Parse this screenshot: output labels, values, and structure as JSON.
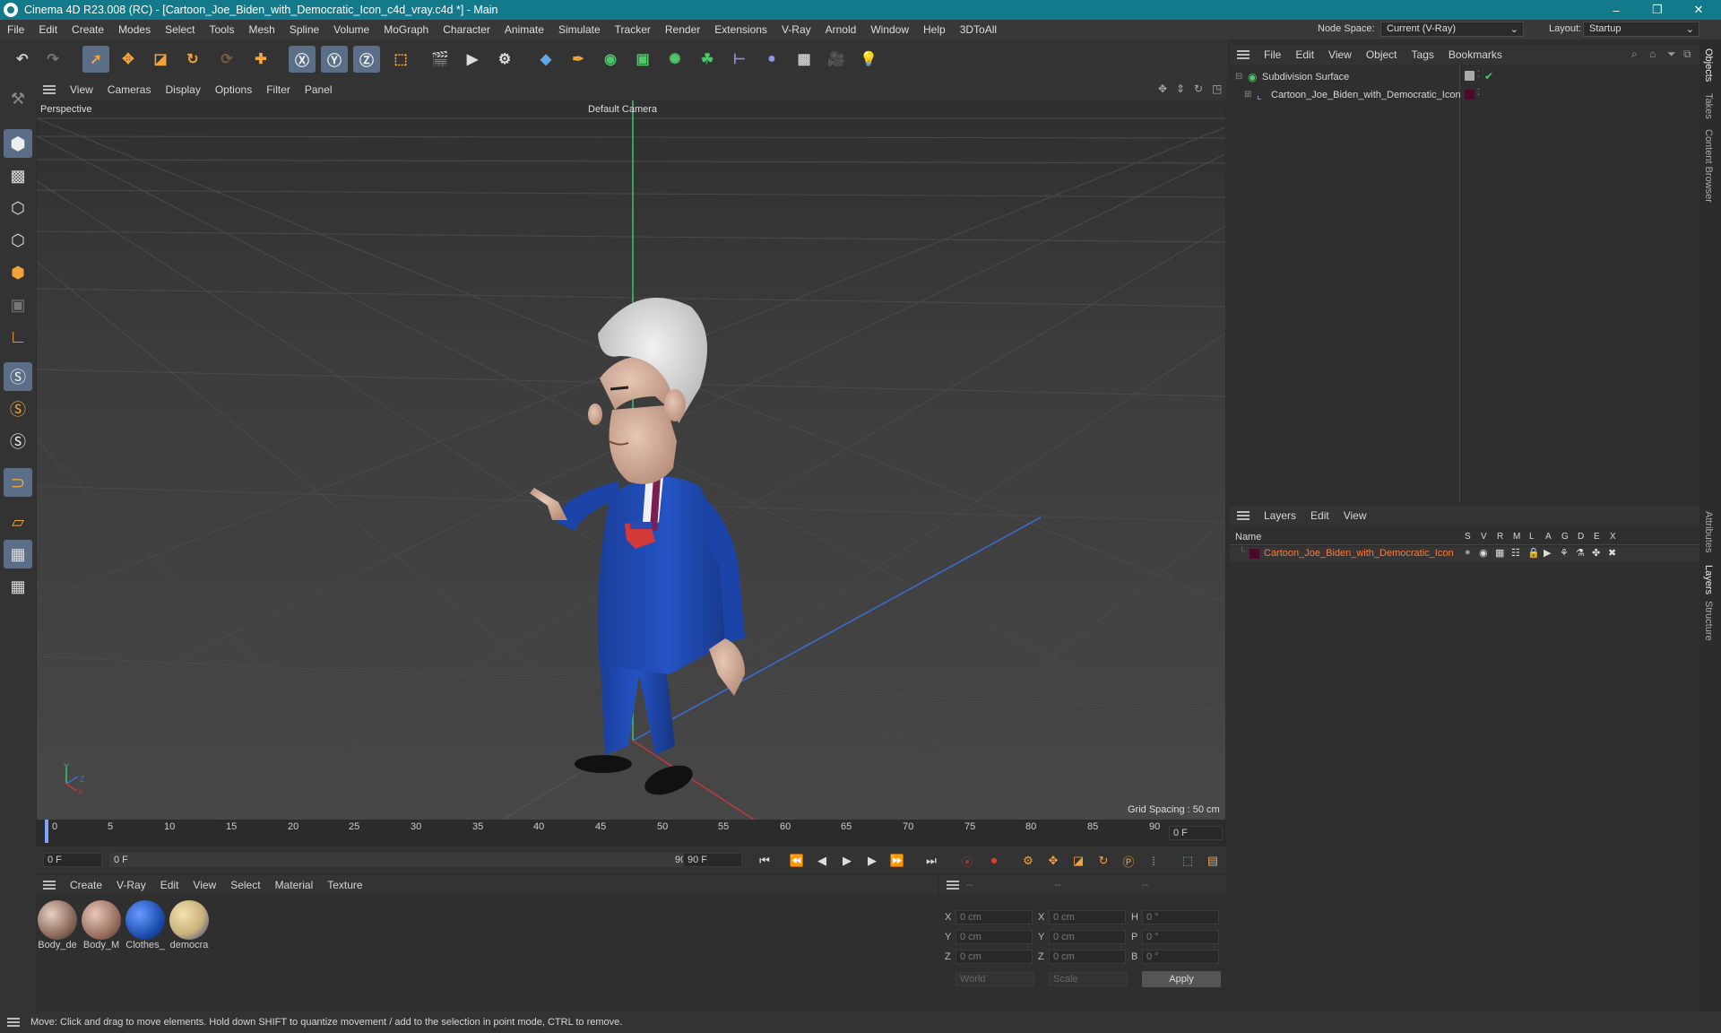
{
  "titlebar": {
    "title": "Cinema 4D R23.008 (RC) - [Cartoon_Joe_Biden_with_Democratic_Icon_c4d_vray.c4d *] - Main",
    "minimize": "–",
    "maximize": "❐",
    "close": "✕"
  },
  "menu": [
    "File",
    "Edit",
    "Create",
    "Modes",
    "Select",
    "Tools",
    "Mesh",
    "Spline",
    "Volume",
    "MoGraph",
    "Character",
    "Animate",
    "Simulate",
    "Tracker",
    "Render",
    "Extensions",
    "V-Ray",
    "Arnold",
    "Window",
    "Help",
    "3DToAll"
  ],
  "nodespace": {
    "label": "Node Space:",
    "value": "Current (V-Ray)"
  },
  "layout": {
    "label": "Layout:",
    "value": "Startup"
  },
  "viewport_menu": [
    "View",
    "Cameras",
    "Display",
    "Options",
    "Filter",
    "Panel"
  ],
  "viewport": {
    "name": "Perspective",
    "camera": "Default Camera",
    "grid": "Grid Spacing : 50 cm"
  },
  "timeline": {
    "ticks": [
      "0",
      "5",
      "10",
      "15",
      "20",
      "25",
      "30",
      "35",
      "40",
      "45",
      "50",
      "55",
      "60",
      "65",
      "70",
      "75",
      "80",
      "85",
      "90"
    ],
    "frame_field": "0 F"
  },
  "transport": {
    "start": "0 F",
    "current": "0 F",
    "end_inner": "90 F",
    "end": "90 F"
  },
  "material_menu": [
    "Create",
    "V-Ray",
    "Edit",
    "View",
    "Select",
    "Material",
    "Texture"
  ],
  "materials": [
    {
      "name": "Body_de",
      "color": "#8a6a5a"
    },
    {
      "name": "Body_M",
      "color": "#9a7060"
    },
    {
      "name": "Clothes_",
      "color": "#1c4fb0"
    },
    {
      "name": "democra",
      "color": "#c9b27a"
    }
  ],
  "coords": {
    "dashes": [
      "--",
      "--",
      "--"
    ],
    "rows": [
      {
        "a": "X",
        "av": "0 cm",
        "b": "X",
        "bv": "0 cm",
        "c": "H",
        "cv": "0 °"
      },
      {
        "a": "Y",
        "av": "0 cm",
        "b": "Y",
        "bv": "0 cm",
        "c": "P",
        "cv": "0 °"
      },
      {
        "a": "Z",
        "av": "0 cm",
        "b": "Z",
        "bv": "0 cm",
        "c": "B",
        "cv": "0 °"
      }
    ],
    "world": "World",
    "scale": "Scale",
    "apply": "Apply"
  },
  "objects_menu": [
    "File",
    "Edit",
    "View",
    "Object",
    "Tags",
    "Bookmarks"
  ],
  "objects": [
    {
      "name": "Subdivision Surface"
    },
    {
      "name": "Cartoon_Joe_Biden_with_Democratic_Icon"
    }
  ],
  "layers_menu": [
    "Layers",
    "Edit",
    "View"
  ],
  "layers_header": {
    "name": "Name",
    "cols": [
      "S",
      "V",
      "R",
      "M",
      "L",
      "A",
      "G",
      "D",
      "E",
      "X"
    ]
  },
  "layers": [
    {
      "name": "Cartoon_Joe_Biden_with_Democratic_Icon",
      "color": "#ff7a3a"
    }
  ],
  "right_tabs": [
    "Objects",
    "Takes",
    "Content Browser",
    "Attributes",
    "Layers",
    "Structure"
  ],
  "status": "Move: Click and drag to move elements. Hold down SHIFT to quantize movement / add to the selection in point mode, CTRL to remove.",
  "axes": {
    "x": "X",
    "y": "Y",
    "z": "Z"
  }
}
